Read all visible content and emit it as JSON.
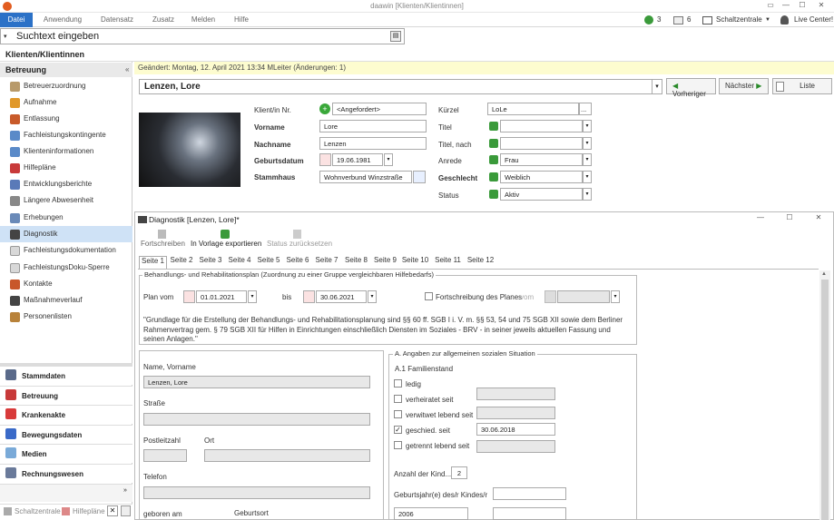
{
  "app": {
    "title": "daawin [Klienten/Klientinnen]"
  },
  "menu": {
    "items": [
      "Datei",
      "Anwendung",
      "Datensatz",
      "Zusatz",
      "Melden",
      "Hilfe"
    ],
    "right": {
      "count1": "3",
      "count2": "6",
      "schaltzentrale": "Schaltzentrale",
      "live": "Live Center!"
    }
  },
  "search": {
    "placeholder": "Suchtext eingeben"
  },
  "section": {
    "title": "Klienten/Klientinnen"
  },
  "sidebar": {
    "title": "Betreuung",
    "items": [
      "Betreuerzuordnung",
      "Aufnahme",
      "Entlassung",
      "Fachleistungskontingente",
      "Klienteninformationen",
      "Hilfepläne",
      "Entwicklungsberichte",
      "Längere Abwesenheit",
      "Erhebungen",
      "Diagnostik",
      "Fachleistungsdokumentation",
      "FachleistungsDoku-Sperre",
      "Kontakte",
      "Maßnahmeverlauf",
      "Personenlisten"
    ],
    "bottom": [
      "Stammdaten",
      "Betreuung",
      "Krankenakte",
      "Bewegungsdaten",
      "Medien",
      "Rechnungswesen"
    ],
    "footer": [
      "Schaltzentrale",
      "Hilfepläne"
    ]
  },
  "info": {
    "changed": "Geändert: Montag, 12. April 2021 13:34  MLeiter  (Änderungen: 1)"
  },
  "client": {
    "name": "Lenzen, Lore",
    "prev": "Vorheriger",
    "next": "Nächster",
    "list": "Liste",
    "labels": {
      "nr": "Klient/in Nr.",
      "vorname": "Vorname",
      "nachname": "Nachname",
      "geburtsdatum": "Geburtsdatum",
      "stammhaus": "Stammhaus",
      "kuerzel": "Kürzel",
      "titel": "Titel",
      "titel_nach": "Titel, nach",
      "anrede": "Anrede",
      "geschlecht": "Geschlecht",
      "status": "Status"
    },
    "values": {
      "nr": "<Angefordert>",
      "vorname": "Lore",
      "nachname": "Lenzen",
      "geburtsdatum": "19.06.1981",
      "stammhaus": "Wohnverbund Winzstraße",
      "kuerzel": "LoLe",
      "kuerzel_btn": "...",
      "anrede": "Frau",
      "geschlecht": "Weiblich",
      "status": "Aktiv"
    }
  },
  "dialog": {
    "title": "Diagnostik [Lenzen, Lore]*",
    "toolbar": [
      "Fortschreiben",
      "In Vorlage exportieren",
      "Status zurücksetzen"
    ],
    "tabs": [
      "Seite 1",
      "Seite 2",
      "Seite 3",
      "Seite 4",
      "Seite 5",
      "Seite 6",
      "Seite 7",
      "Seite 8",
      "Seite 9",
      "Seite 10",
      "Seite 11",
      "Seite 12"
    ],
    "plan": {
      "group": "Behandlungs- und Rehabilitationsplan (Zuordnung zu einer Gruppe vergleichbaren Hilfebedarfs)",
      "plan_vom": "Plan vom",
      "from": "01.01.2021",
      "bis": "bis",
      "to": "30.06.2021",
      "fortschreibung": "Fortschreibung des Planes",
      "vom": "vom",
      "text": "\"Grundlage für die Erstellung der Behandlungs- und Rehabilitationsplanung sind §§ 60 ff. SGB I i. V. m. §§ 53, 54 und 75 SGB XII sowie dem Berliner Rahmenvertrag gem. § 79 SGB XII für Hilfen in Einrichtungen einschließlich Diensten im Soziales - BRV - in seiner jeweils aktuellen Fassung und seinen Anlagen.\""
    },
    "person": {
      "name_lbl": "Name, Vorname",
      "name_val": "Lenzen, Lore",
      "strasse": "Straße",
      "plz": "Postleitzahl",
      "ort": "Ort",
      "telefon": "Telefon",
      "geboren": "geboren am",
      "geburtsort": "Geburtsort"
    },
    "angaben": {
      "group": "A. Angaben zur allgemeinen sozialen Situation",
      "sub": "A.1 Familienstand",
      "options": [
        "ledig",
        "verheiratet seit",
        "verwitwet lebend seit",
        "geschied. seit",
        "getrennt lebend seit"
      ],
      "geschieden_date": "30.06.2018",
      "kinder_lbl": "Anzahl der Kind...",
      "kinder_val": "2",
      "gebjahr_lbl": "Geburtsjahr(e) des/r Kindes/r",
      "gebjahr_val": "2006"
    }
  }
}
